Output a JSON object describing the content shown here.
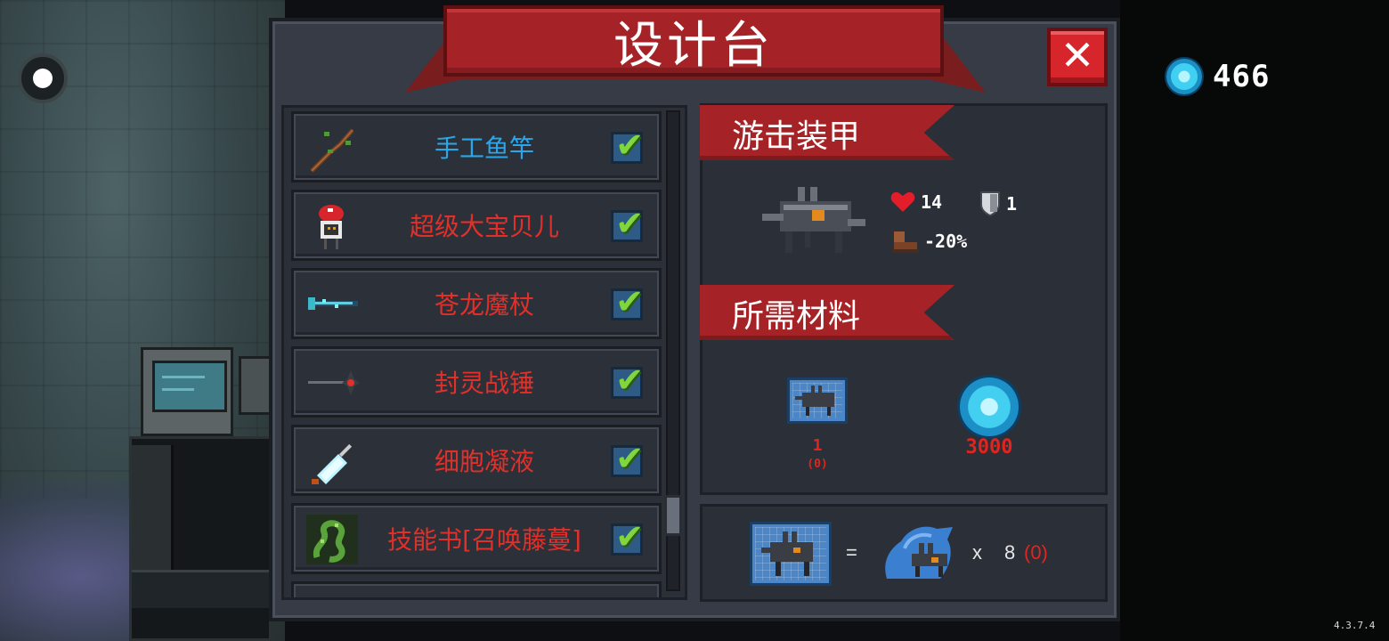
{
  "hud": {
    "gem_count": "466",
    "version": "4.3.7.4"
  },
  "panel": {
    "title": "设计台",
    "close_icon": "✕"
  },
  "list": {
    "check_icon": "✔",
    "items": [
      {
        "name": "手工鱼竿",
        "color": "#2aa7ea",
        "icon": "fishing-rod-icon"
      },
      {
        "name": "超级大宝贝儿",
        "color": "#e1302a",
        "icon": "baby-robot-icon"
      },
      {
        "name": "苍龙魔杖",
        "color": "#e1302a",
        "icon": "dragon-staff-icon"
      },
      {
        "name": "封灵战锤",
        "color": "#e1302a",
        "icon": "war-hammer-icon"
      },
      {
        "name": "细胞凝液",
        "color": "#e1302a",
        "icon": "cell-serum-icon"
      },
      {
        "name": "技能书[召唤藤蔓]",
        "color": "#e1302a",
        "icon": "vine-skill-book-icon"
      }
    ]
  },
  "detail": {
    "item_title": "游击装甲",
    "stats": {
      "health": "14",
      "armor": "1",
      "speed": "-20%"
    },
    "materials_title": "所需材料",
    "materials": {
      "blueprint_required": "1",
      "blueprint_owned": "(0)",
      "gem_cost": "3000"
    },
    "recipe": {
      "equals": "=",
      "times": "x",
      "quantity": "8",
      "owned": "(0)"
    }
  }
}
